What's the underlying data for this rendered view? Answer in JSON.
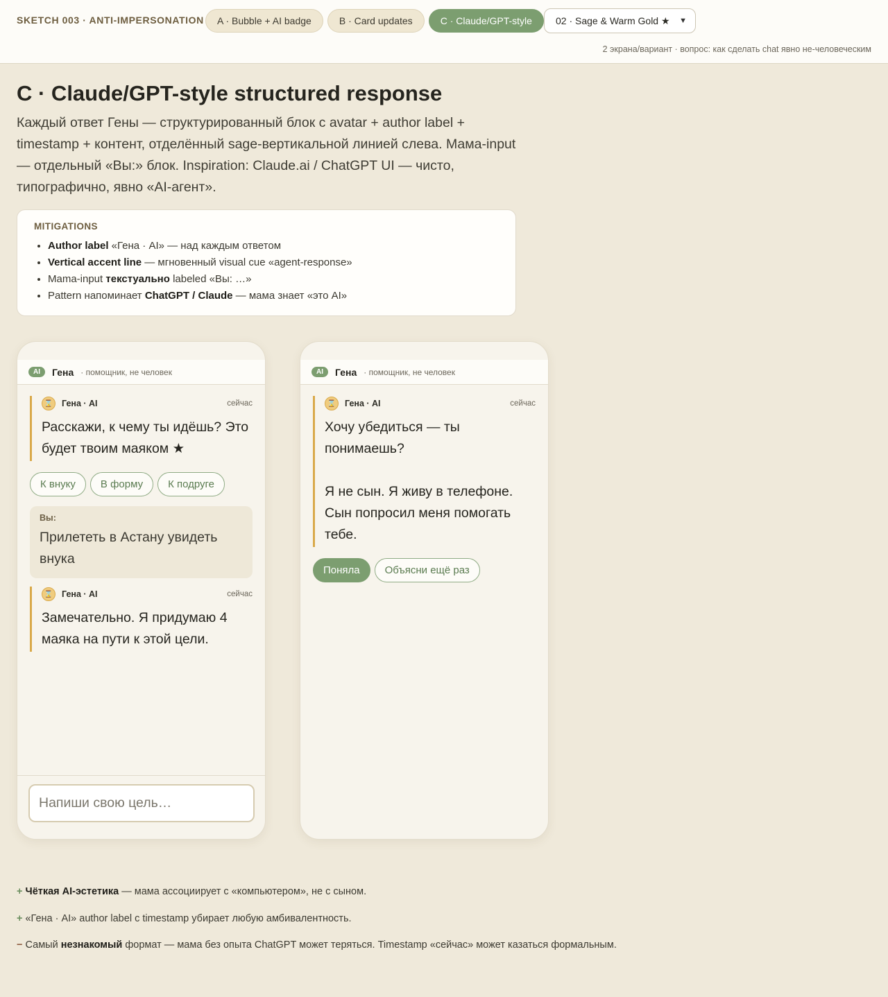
{
  "topbar": {
    "brand": "SKETCH 003 · ANTI-IMPERSONATION",
    "tabs": [
      {
        "label": "A · Bubble + AI badge"
      },
      {
        "label": "B · Card updates"
      },
      {
        "label": "C · Claude/GPT-style"
      }
    ],
    "palette_select": "02 · Sage & Warm Gold ★",
    "subnote": "2 экрана/вариант · вопрос: как сделать chat явно не-человеческим"
  },
  "header": {
    "title": "C · Claude/GPT-style structured response",
    "intro": "Каждый ответ Гены — структурированный блок с avatar + author label + timestamp + контент, отделённый sage-вертикальной линией слева. Мама-input — отдельный «Вы:» блок. Inspiration: Claude.ai / ChatGPT UI — чисто, типографично, явно «AI-агент»."
  },
  "mitigations": {
    "title": "MITIGATIONS",
    "items": [
      {
        "bold": "Author label",
        "rest": " «Гена · AI» — над каждым ответом"
      },
      {
        "bold": "Vertical accent line",
        "rest": " — мгновенный visual cue «agent-response»"
      },
      {
        "pre": "Mama-input ",
        "bold": "текстуально",
        "rest": " labeled «Вы: …»"
      },
      {
        "pre": "Pattern напоминает ",
        "bold": "ChatGPT / Claude",
        "rest": " — мама знает «это AI»"
      }
    ]
  },
  "phones": {
    "header": {
      "badge": "AI",
      "name": "Гена",
      "sub": "· помощник, не человек"
    },
    "left": {
      "msg1": {
        "avatar": "⌛",
        "author": "Гена · AI",
        "time": "сейчас",
        "text": "Расскажи, к чему ты идёшь? Это будет твоим маяком ★"
      },
      "chips": [
        "К внуку",
        "В форму",
        "К подруге"
      ],
      "user": {
        "label": "Вы:",
        "text": "Прилететь в Астану увидеть внука"
      },
      "msg2": {
        "avatar": "⌛",
        "author": "Гена · AI",
        "time": "сейчас",
        "text": "Замечательно. Я придумаю 4 маяка на пути к этой цели."
      },
      "input_placeholder": "Напиши свою цель…"
    },
    "right": {
      "msg1": {
        "avatar": "⌛",
        "author": "Гена · AI",
        "time": "сейчас",
        "text_p1": "Хочу убедиться — ты понимаешь?",
        "text_p2": "Я не сын. Я живу в телефоне. Сын попросил меня помогать тебе."
      },
      "chips": [
        "Поняла",
        "Объясни ещё раз"
      ]
    }
  },
  "notes": [
    {
      "sign": "+",
      "bold": "Чёткая AI-эстетика",
      "rest": " — мама ассоциирует с «компьютером», не с сыном."
    },
    {
      "sign": "+",
      "rest": " «Гена · AI» author label с timestamp убирает любую амбивалентность."
    },
    {
      "sign": "−",
      "pre": " Самый ",
      "bold": "незнакомый",
      "rest": " формат — мама без опыта ChatGPT может теряться. Timestamp «сейчас» может казаться формальным."
    }
  ],
  "colors": {
    "sage": "#7c9e70",
    "gold": "#d9a94a",
    "background": "#efe9da"
  }
}
